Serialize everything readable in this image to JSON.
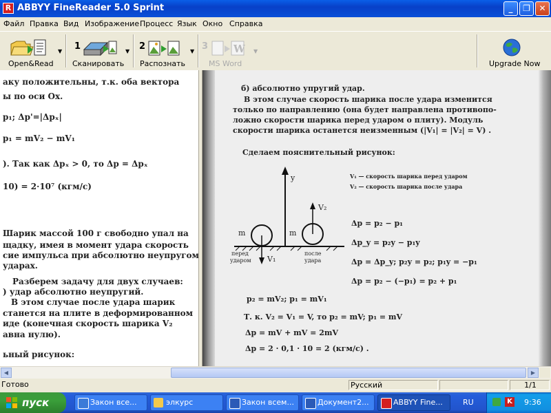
{
  "window": {
    "title": "ABBYY FineReader 5.0 Sprint",
    "app_icon": "R",
    "minimize": "_",
    "maximize": "❐",
    "close": "✕"
  },
  "menu": [
    "Файл",
    "Правка",
    "Вид",
    "Изображение",
    "Процесс",
    "Язык",
    "Окно",
    "Справка"
  ],
  "toolbar": {
    "open_read": "Open&Read",
    "scan_num": "1",
    "scan": "Сканировать",
    "recognize_num": "2",
    "recognize": "Распознать",
    "msword_num": "3",
    "msword": "MS Word",
    "upgrade": "Upgrade Now"
  },
  "left_page": {
    "l1": "аку положительны, т.к. оба вектора",
    "l2": "ы по оси Ox.",
    "l3": "p₁;   Δp'=|Δpₓ|",
    "l4": "p₁ = mV₂ − mV₁",
    "l5": "). Так как Δpₓ > 0, то Δp = Δpₓ",
    "l6": "10) = 2·10⁷ (кгм/с)",
    "l7": "Шарик массой 100 г свободно упал на",
    "l8": "щадку, имея в момент удара скорость",
    "l9": "сие импульса при абсолютно неупругом",
    "l10": " ударах.",
    "l11": "Разберем задачу для двух случаев:",
    "l12": ") удар абсолютно неупругий.",
    "l13": "В этом случае после удара шарик",
    "l14": "станется на плите в деформированном",
    "l15": "иде (конечная скорость шарика V₂",
    "l16": "авна нулю).",
    "l17": "ьный рисунок:"
  },
  "right_page": {
    "r1": "б) абсолютно упругий удар.",
    "r2": "В этом случае скорость шарика после удара изменится",
    "r3": "только по направлению (она будет направлена противопо-",
    "r4": "ложно скорости шарика перед ударом о плиту). Модуль",
    "r5": "скорости шарика останется неизменным (|V₁| = |V₂| = V) .",
    "r6": "Сделаем пояснительный рисунок:",
    "legend1": "V₁ — скорость шарика перед ударом",
    "legend2": "V₂ — скорость шарика после удара",
    "axis_y": "y",
    "mass1": "m",
    "mass2": "m",
    "v1": "V₁",
    "v2": "V₂",
    "before": "перед",
    "before2": "ударом",
    "after": "после",
    "after2": "удара",
    "e1": "Δp = p₂ − p₁",
    "e2": "Δp_y = p₂y − p₁y",
    "e3": "Δp = Δp_y;   p₂y = p₂;   p₁y = −p₁",
    "e4": "Δp = p₂ − (−p₁) = p₂ + p₁",
    "e5": "p₂ = mV₂;    p₁ = mV₁",
    "e6": "Т. к.  V₂ = V₁ = V,  то  p₂ = mV;     p₁ = mV",
    "e7": "Δp = mV + mV = 2mV",
    "e8": "Δp = 2 · 0,1 · 10 = 2 (кгм/с) ."
  },
  "status": {
    "ready": "Готово",
    "language": "Русский",
    "page": "1/1"
  },
  "taskbar": {
    "start": "пуск",
    "tasks": [
      "Закон все...",
      "элкурс",
      "Закон всем...",
      "Документ2...",
      "ABBYY Fine..."
    ],
    "lang": "RU",
    "clock": "9:36"
  }
}
